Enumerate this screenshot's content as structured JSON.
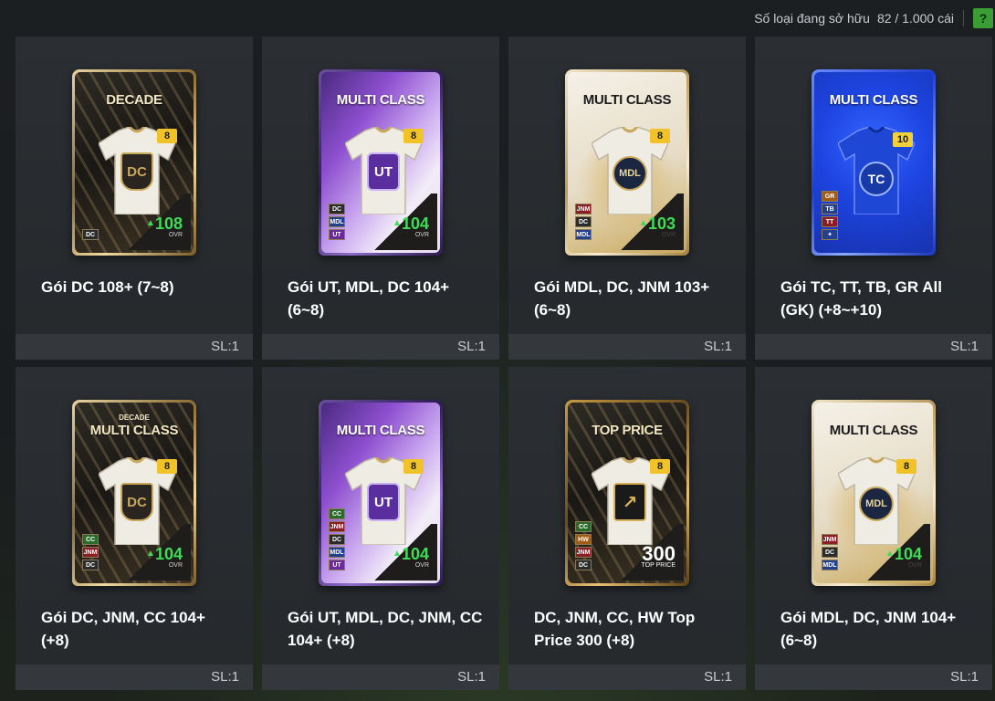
{
  "header": {
    "owned_label": "Số loại đang sở hữu",
    "owned_value": "82 / 1.000 cái",
    "help_label": "?"
  },
  "packs": [
    {
      "name": "Gói DC 108+ (7~8)",
      "qty": "SL:1",
      "card": {
        "style": "gold",
        "subtitle": "",
        "title": "DECADE",
        "level": "8",
        "badge": "DC",
        "tags": [
          "DC"
        ],
        "ovr": "108",
        "ovr_label": "OVR"
      }
    },
    {
      "name": "Gói UT, MDL, DC 104+ (6~8)",
      "qty": "SL:1",
      "card": {
        "style": "purple",
        "subtitle": "",
        "title": "MULTI CLASS",
        "level": "8",
        "badge": "UT",
        "tags": [
          "DC",
          "MDL",
          "UT"
        ],
        "ovr": "104",
        "ovr_label": "OVR"
      }
    },
    {
      "name": "Gói MDL, DC, JNM 103+ (6~8)",
      "qty": "SL:1",
      "card": {
        "style": "white",
        "subtitle": "",
        "title": "MULTI CLASS",
        "level": "8",
        "badge": "MDL",
        "tags": [
          "JNM",
          "DC",
          "MDL"
        ],
        "ovr": "103",
        "ovr_label": "OVR"
      }
    },
    {
      "name": "Gói TC, TT, TB, GR All (GK) (+8~+10)",
      "qty": "SL:1",
      "card": {
        "style": "blue",
        "subtitle": "",
        "title": "MULTI CLASS",
        "level": "10",
        "badge": "TC",
        "tags": [
          "GR",
          "TB",
          "TT",
          "✦"
        ],
        "ovr": "",
        "ovr_label": ""
      }
    },
    {
      "name": "Gói DC, JNM, CC 104+ (+8)",
      "qty": "SL:1",
      "card": {
        "style": "gold",
        "subtitle": "DECADE",
        "title": "MULTI CLASS",
        "level": "8",
        "badge": "DC",
        "tags": [
          "CC",
          "JNM",
          "DC"
        ],
        "ovr": "104",
        "ovr_label": "OVR"
      }
    },
    {
      "name": "Gói UT, MDL, DC, JNM, CC 104+ (+8)",
      "qty": "SL:1",
      "card": {
        "style": "purple",
        "subtitle": "",
        "title": "MULTI CLASS",
        "level": "8",
        "badge": "UT",
        "tags": [
          "CC",
          "JNM",
          "DC",
          "MDL",
          "UT"
        ],
        "ovr": "104",
        "ovr_label": "OVR"
      }
    },
    {
      "name": "DC, JNM, CC, HW Top Price 300 (+8)",
      "qty": "SL:1",
      "card": {
        "style": "topprice",
        "subtitle": "",
        "title": "TOP PRICE",
        "level": "8",
        "badge": "↗",
        "tags": [
          "CC",
          "HW",
          "JNM",
          "DC"
        ],
        "ovr": "300",
        "ovr_label": "TOP PRICE"
      }
    },
    {
      "name": "Gói MDL, DC, JNM 104+ (6~8)",
      "qty": "SL:1",
      "card": {
        "style": "white",
        "subtitle": "",
        "title": "MULTI CLASS",
        "level": "8",
        "badge": "MDL",
        "tags": [
          "JNM",
          "DC",
          "MDL"
        ],
        "ovr": "104",
        "ovr_label": "OVR"
      }
    }
  ]
}
